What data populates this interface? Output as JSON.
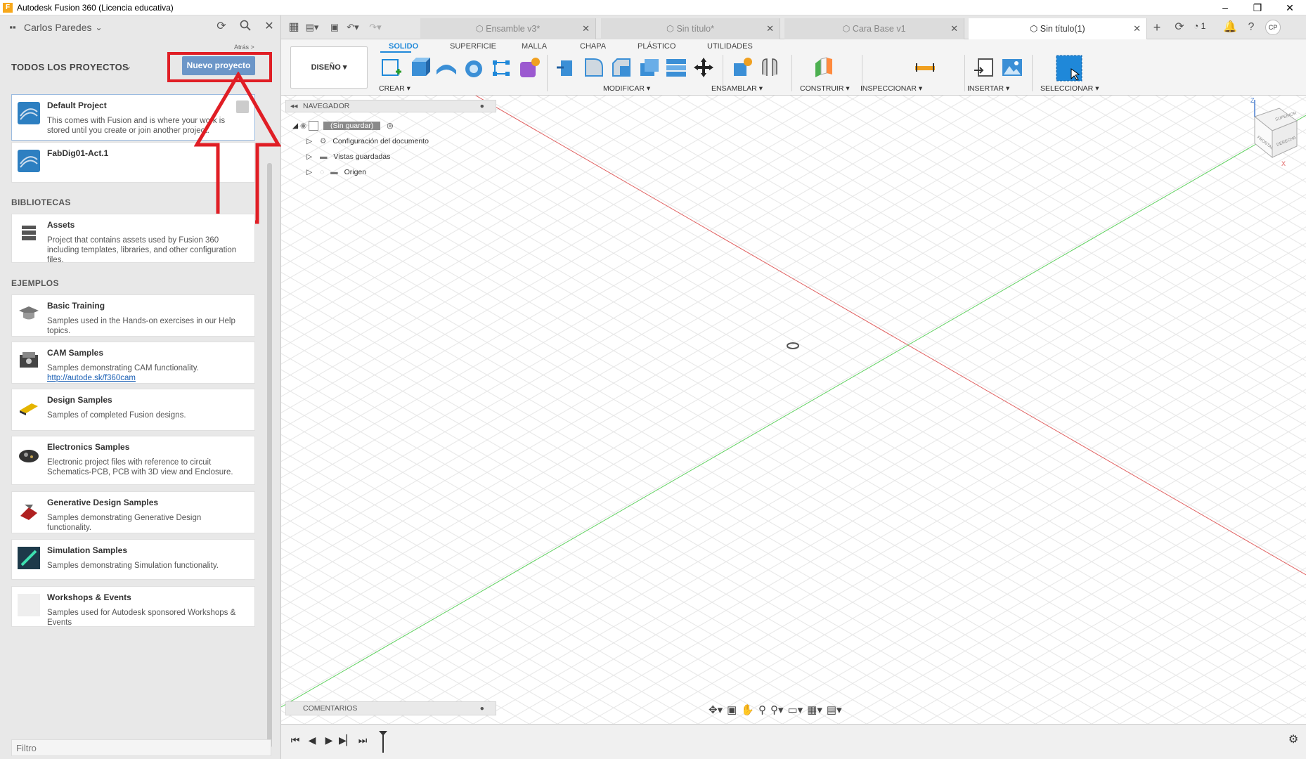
{
  "window": {
    "title": "Autodesk Fusion 360 (Licencia educativa)",
    "controls": [
      "–",
      "❐",
      "✕"
    ]
  },
  "left_panel": {
    "user": "Carlos Paredes",
    "back_link": "Atrás >",
    "projects_title": "TODOS LOS PROYECTOS",
    "new_project_label": "Nuevo proyecto",
    "projects": [
      {
        "name": "Default Project",
        "desc": "This comes with Fusion and is where your work is stored until you create or join another project."
      },
      {
        "name": "FabDig01-Act.1",
        "desc": ""
      }
    ],
    "libraries_title": "BIBLIOTECAS",
    "libraries": [
      {
        "name": "Assets",
        "desc": "Project that contains assets used by Fusion 360 including templates, libraries, and other configuration files."
      }
    ],
    "examples_title": "EJEMPLOS",
    "examples": [
      {
        "name": "Basic Training",
        "desc": "Samples used in the Hands-on exercises in our Help topics."
      },
      {
        "name": "CAM Samples",
        "desc": "Samples demonstrating CAM functionality.",
        "link": "http://autode.sk/f360cam"
      },
      {
        "name": "Design Samples",
        "desc": "Samples of completed Fusion designs."
      },
      {
        "name": "Electronics Samples",
        "desc": "Electronic project files with reference to circuit Schematics-PCB, PCB with 3D view and Enclosure."
      },
      {
        "name": "Generative Design Samples",
        "desc": "Samples demonstrating Generative Design functionality."
      },
      {
        "name": "Simulation Samples",
        "desc": "Samples demonstrating Simulation functionality."
      },
      {
        "name": "Workshops & Events",
        "desc": "Samples used for Autodesk sponsored Workshops & Events"
      }
    ],
    "filter_placeholder": "Filtro"
  },
  "tabs": [
    {
      "label": "Ensamble v3*",
      "active": false
    },
    {
      "label": "Sin título*",
      "active": false
    },
    {
      "label": "Cara Base v1",
      "active": false
    },
    {
      "label": "Sin título(1)",
      "active": true
    }
  ],
  "header_right": {
    "jobs_count": "1",
    "avatar": "CP"
  },
  "ribbon": {
    "workspace": "DISEÑO",
    "tabs": [
      "SOLIDO",
      "SUPERFICIE",
      "MALLA",
      "CHAPA",
      "PLÁSTICO",
      "UTILIDADES"
    ],
    "groups": [
      "CREAR",
      "MODIFICAR",
      "ENSAMBLAR",
      "CONSTRUIR",
      "INSPECCIONAR",
      "INSERTAR",
      "SELECCIONAR"
    ]
  },
  "browser": {
    "title": "NAVEGADOR",
    "root": "(Sin guardar)",
    "items": [
      "Configuración del documento",
      "Vistas guardadas",
      "Origen"
    ]
  },
  "comments_title": "COMENTARIOS",
  "viewcube": {
    "faces": [
      "SUPERIOR",
      "FRONTAL",
      "DERECHA"
    ],
    "axes": [
      "Z",
      "X"
    ]
  },
  "colors": {
    "accent": "#1f88d9",
    "highlight": "#e01e25",
    "button": "#6c96c8",
    "x_axis": "#e06060",
    "y_axis": "#60d060"
  }
}
